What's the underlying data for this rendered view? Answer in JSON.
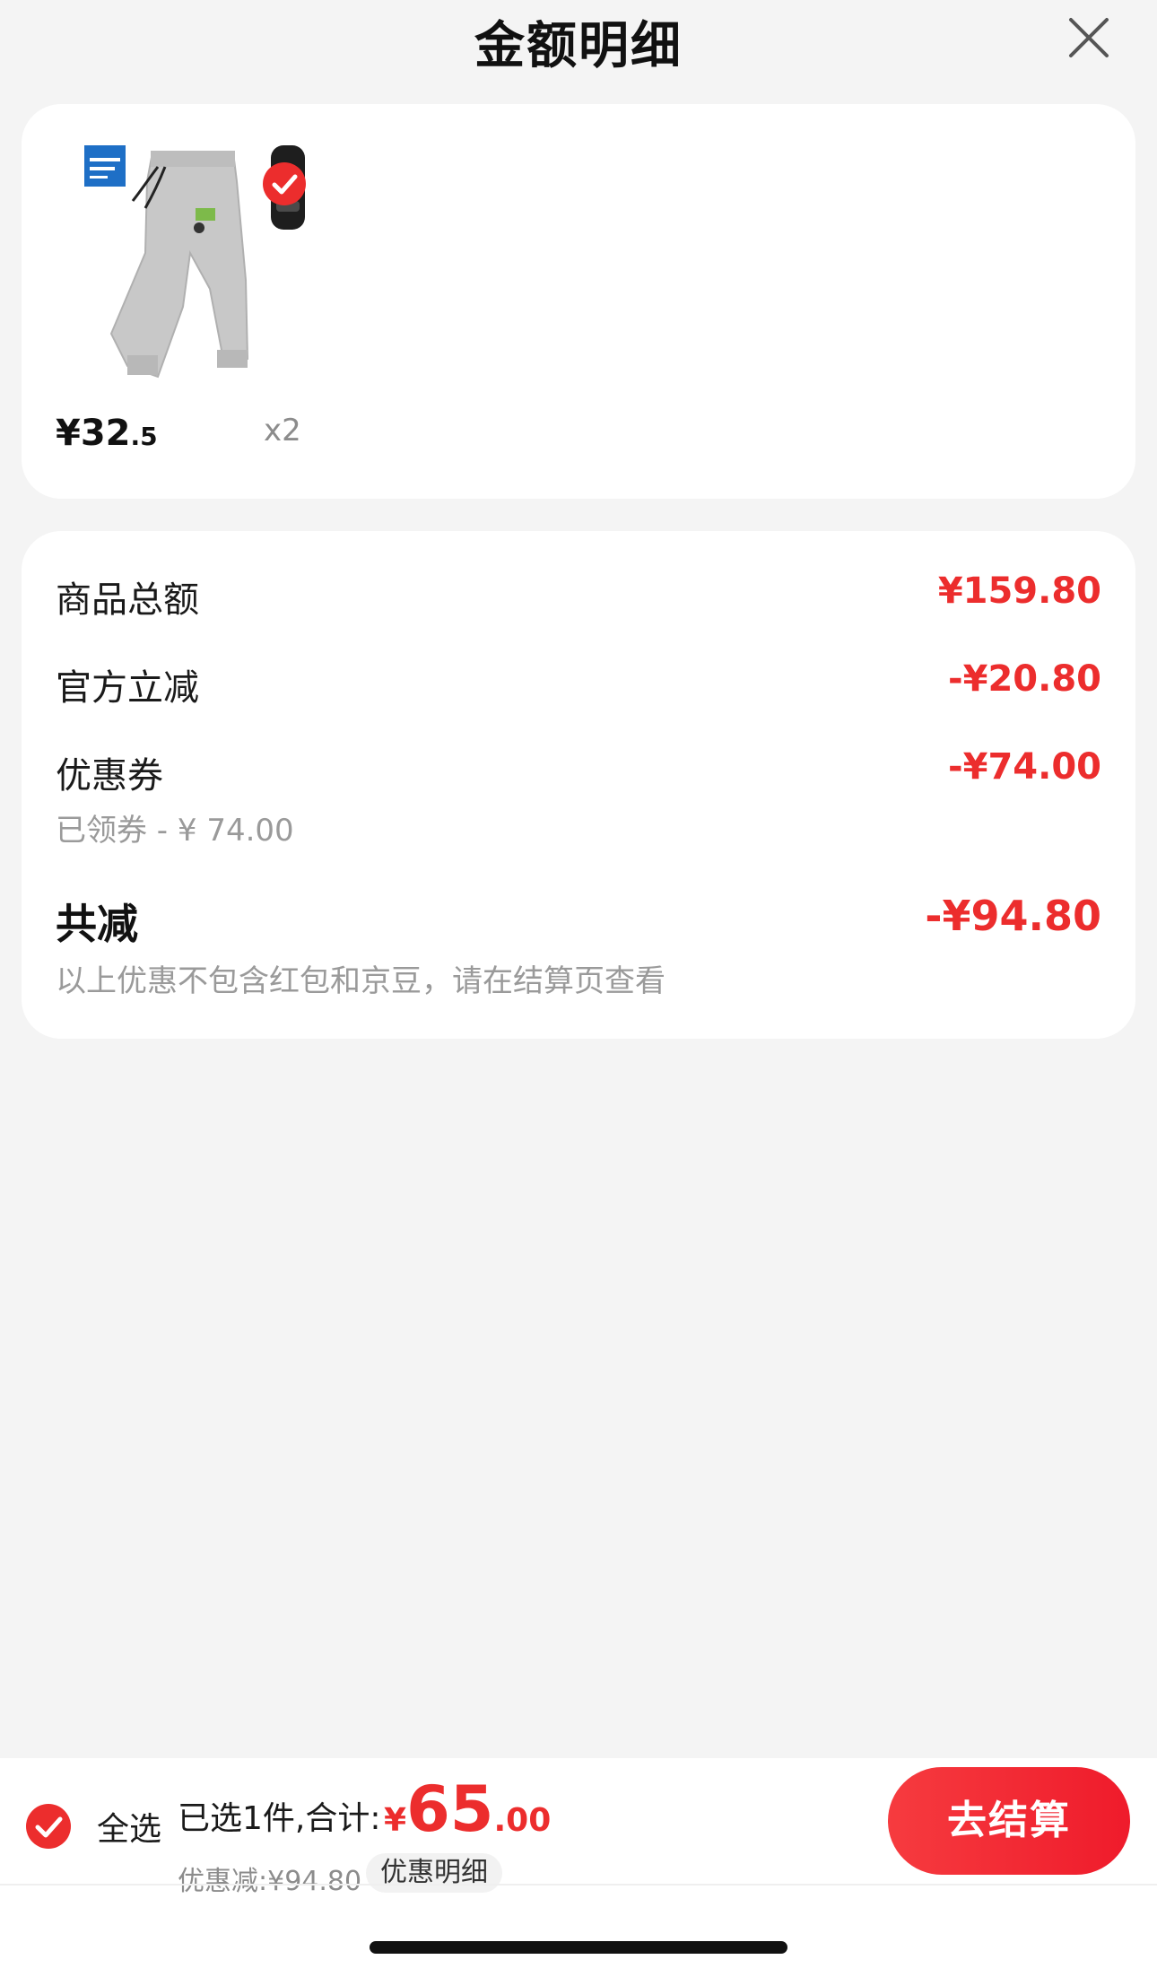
{
  "header": {
    "title": "金额明细",
    "close_icon": "close-icon"
  },
  "product": {
    "image_icon": "grey-jogger-pants-thumbnail",
    "brand_badge_icon": "jeanswest-logo-badge",
    "selected_icon": "check-circle-icon",
    "price_symbol": "¥",
    "price_int": "32",
    "price_dec": ".5",
    "quantity": "x2"
  },
  "summary": {
    "rows": [
      {
        "label": "商品总额",
        "value": "¥159.80"
      },
      {
        "label": "官方立减",
        "value": "-¥20.80"
      },
      {
        "label": "优惠券",
        "value": "-¥74.00",
        "sub": "已领券 - ¥ 74.00"
      }
    ],
    "total": {
      "label": "共减",
      "value": "-¥94.80",
      "note": "以上优惠不包含红包和京豆，请在结算页查看"
    }
  },
  "bottom_bar": {
    "select_all_label": "全选",
    "selected_text": "已选1件,合计:",
    "total_symbol": "¥",
    "total_int": "65",
    "total_dec": ".00",
    "discount_text": "优惠减:¥94.80",
    "detail_chip": "优惠明细",
    "checkout_label": "去结算"
  },
  "colors": {
    "accent_red": "#ec2d2d",
    "background": "#f4f4f4",
    "card": "#ffffff"
  }
}
